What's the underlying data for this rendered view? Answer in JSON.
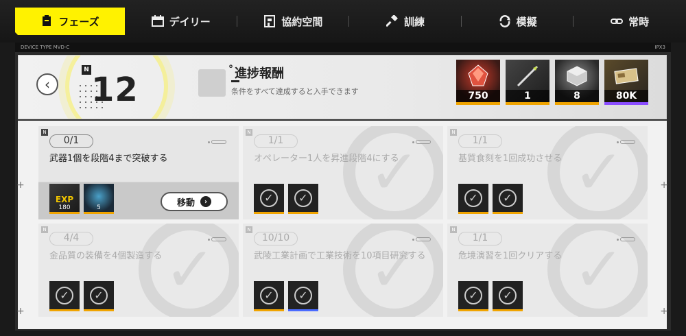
{
  "tabs": [
    {
      "label": "フェーズ",
      "icon": "phase-icon",
      "active": true
    },
    {
      "label": "デイリー",
      "icon": "calendar-icon"
    },
    {
      "label": "協約空間",
      "icon": "pact-icon"
    },
    {
      "label": "訓練",
      "icon": "hammer-icon"
    },
    {
      "label": "模擬",
      "icon": "simulation-icon"
    },
    {
      "label": "常時",
      "icon": "link-icon"
    }
  ],
  "header_strip": {
    "left": "DEVICE TYPE MVD-C",
    "right": "IPX3"
  },
  "phase": {
    "logo": "N",
    "number": "12"
  },
  "reward": {
    "title": "進捗報酬",
    "subtitle": "条件をすべて達成すると入手できます",
    "items": [
      {
        "count": "750",
        "rarity": "gold"
      },
      {
        "count": "1",
        "rarity": "gold"
      },
      {
        "count": "8",
        "rarity": "gold"
      },
      {
        "count": "80K",
        "rarity": "purple"
      }
    ]
  },
  "tasks": [
    {
      "progress": "0/1",
      "desc": "武器1個を段階4まで突破する",
      "done": false,
      "rewards": [
        {
          "type": "exp",
          "label": "EXP",
          "count": "180"
        },
        {
          "type": "cube",
          "count": "5"
        }
      ],
      "action": "移動"
    },
    {
      "progress": "1/1",
      "desc": "オペレーター1人を昇進段階4にする",
      "done": true
    },
    {
      "progress": "1/1",
      "desc": "基質食刻を1回成功させる",
      "done": true
    },
    {
      "progress": "4/4",
      "desc": "金品質の装備を4個製造する",
      "done": true
    },
    {
      "progress": "10/10",
      "desc": "武陵工業計画で工業技術を10項目研究する",
      "done": true
    },
    {
      "progress": "1/1",
      "desc": "危境演習を1回クリアする",
      "done": true
    }
  ]
}
